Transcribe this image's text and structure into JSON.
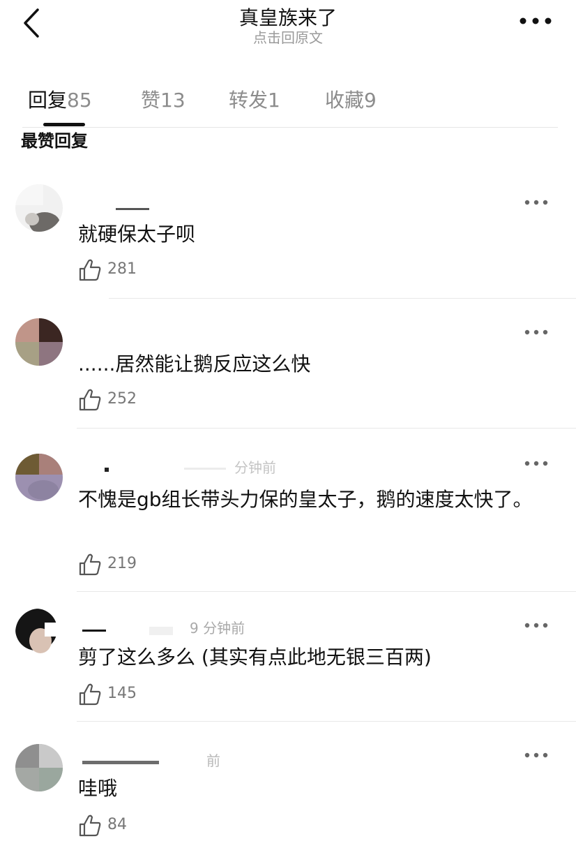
{
  "header": {
    "title": "真皇族来了",
    "subtitle": "点击回原文",
    "icons": {
      "back": "chevron-left-icon",
      "more": "more-horizontal-icon"
    }
  },
  "tabs": [
    {
      "label": "回复",
      "count": "85",
      "active": true
    },
    {
      "label": "赞",
      "count": "13",
      "active": false
    },
    {
      "label": "转发",
      "count": "1",
      "active": false
    },
    {
      "label": "收藏",
      "count": "9",
      "active": false
    }
  ],
  "section_title": "最赞回复",
  "comments": [
    {
      "time": "",
      "text": "就硬保太子呗",
      "likes": "281"
    },
    {
      "time": "",
      "text": "......居然能让鹅反应这么快",
      "likes": "252"
    },
    {
      "time": "分钟前",
      "text": "不愧是gb组长带头力保的皇太子，鹅的速度太快了。",
      "likes": "219"
    },
    {
      "time": "9 分钟前",
      "text": "剪了这么多么 (其实有点此地无银三百两)",
      "likes": "145"
    },
    {
      "time": "前",
      "text": "哇哦",
      "likes": "84"
    }
  ],
  "colors": {
    "text": "#111111",
    "secondary": "#9a9a9a",
    "divider": "#e8e8e8",
    "accent_indicator": "#111111"
  }
}
